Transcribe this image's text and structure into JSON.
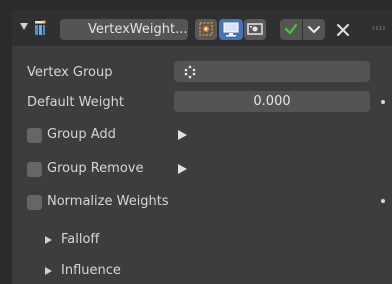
{
  "header": {
    "modifier_icon": "vertex-weight-modifier-icon",
    "modifier_name": "VertexWeight...",
    "buttons": [
      {
        "icon": "edit-mode-icon",
        "active": false
      },
      {
        "icon": "realtime-display-icon",
        "active": true
      },
      {
        "icon": "render-camera-icon",
        "active": false
      },
      {
        "icon": "checkmark-icon",
        "color": "#45c445"
      },
      {
        "icon": "chevron-down-icon"
      },
      {
        "icon": "close-icon"
      }
    ]
  },
  "properties": {
    "vertex_group_label": "Vertex Group",
    "vertex_group_value": "",
    "default_weight_label": "Default Weight",
    "default_weight_value": "0.000"
  },
  "options": {
    "group_add": {
      "label": "Group Add",
      "checked": false
    },
    "group_remove": {
      "label": "Group Remove",
      "checked": false
    },
    "normalize_weights": {
      "label": "Normalize Weights",
      "checked": false
    }
  },
  "subpanels": {
    "falloff": "Falloff",
    "influence": "Influence"
  },
  "colors": {
    "accent": "#4772b3",
    "check": "#45c445"
  }
}
